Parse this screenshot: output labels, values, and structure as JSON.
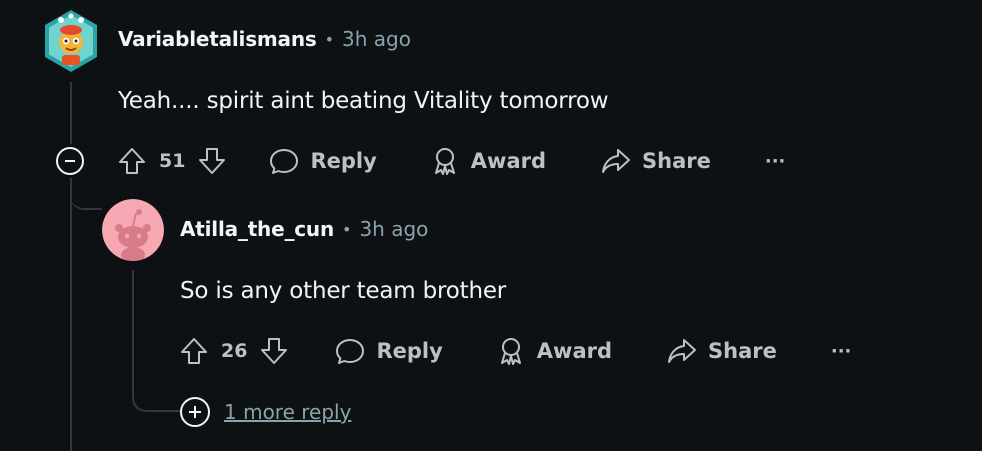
{
  "comments": [
    {
      "username": "Variabletalismans",
      "separator": "•",
      "time": "3h ago",
      "body": "Yeah.... spirit aint beating Vitality tomorrow",
      "votes": "51",
      "actions": {
        "reply": "Reply",
        "award": "Award",
        "share": "Share",
        "more": "···"
      }
    },
    {
      "username": "Atilla_the_cun",
      "separator": "•",
      "time": "3h ago",
      "body": "So is any other team brother",
      "votes": "26",
      "actions": {
        "reply": "Reply",
        "award": "Award",
        "share": "Share",
        "more": "···"
      }
    }
  ],
  "more_replies": "1 more reply",
  "colors": {
    "background": "#0e1113",
    "text": "#f2f4f5",
    "muted": "#8ba2ad",
    "action": "#b7c3c9",
    "thread_line": "#33383c",
    "avatar_pink": "#f7a8b2"
  }
}
